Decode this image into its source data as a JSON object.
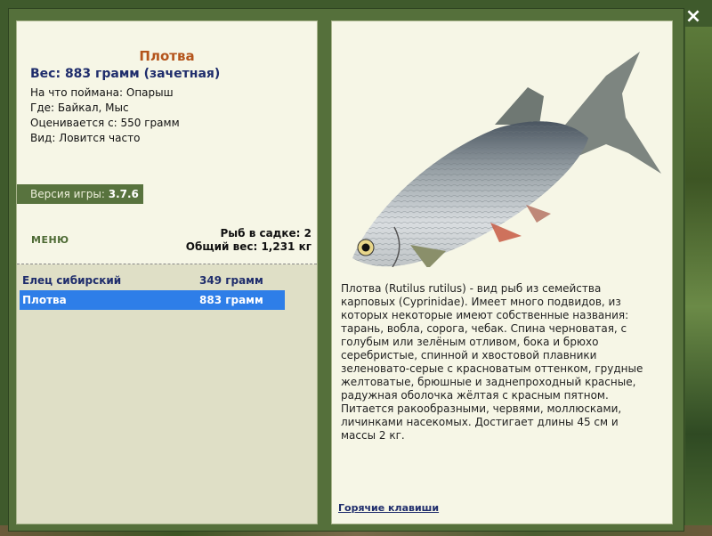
{
  "colors": {
    "accent_title": "#b4541b",
    "weight_text": "#1f2d6c",
    "selected_row": "#2e7ee8",
    "panel_bg": "#f6f6e6",
    "frame": "#55703b"
  },
  "window": {
    "close_icon": "close-icon",
    "close_label": "×"
  },
  "fish": {
    "name": "Плотва",
    "weight": "Вес: 883 грамм (зачетная)",
    "bait": "На что поймана: Опарыш",
    "place": "Где: Байкал, Мыс",
    "valued_from": "Оценивается с: 550 грамм",
    "frequency": "Вид: Ловится часто"
  },
  "version": {
    "label": "Версия игры: ",
    "number": "3.7.6"
  },
  "menu": {
    "label": "МЕНЮ"
  },
  "stats": {
    "count": "Рыб в садке: 2",
    "total": "Общий вес: 1,231 кг"
  },
  "catch_list": [
    {
      "name": "Елец сибирский",
      "weight": "349 грамм",
      "selected": false
    },
    {
      "name": "Плотва",
      "weight": "883 грамм",
      "selected": true
    }
  ],
  "description": "Плотва (Rutilus rutilus) - вид рыб из семейства карповых (Cyprinidae). Имеет много подвидов, из которых некоторые имеют собственные названия: тарань, вобла, сорога, чебак. Спина черноватая, с голубым или зелёным отливом, бока и брюхо серебристые, спинной и хвостовой плавники зеленовато-серые с красноватым оттенком, грудные желтоватые, брюшные и заднепроходный красные, радужная оболочка жёлтая с красным пятном. Питается ракообразными, червями, моллюсками, личинками насекомых. Достигает длины 45 см и массы 2 кг.",
  "hotkeys": {
    "label": "Горячие клавиши"
  }
}
